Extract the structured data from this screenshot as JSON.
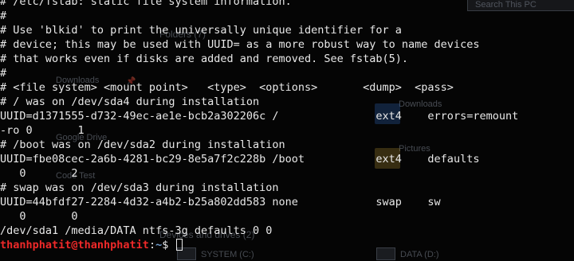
{
  "terminal": {
    "lines": [
      "# /etc/fstab: static file system information.",
      "#",
      "# Use 'blkid' to print the universally unique identifier for a",
      "# device; this may be used with UUID= as a more robust way to name devices",
      "# that works even if disks are added and removed. See fstab(5).",
      "#",
      "# <file system> <mount point>   <type>  <options>       <dump>  <pass>",
      "# / was on /dev/sda4 during installation",
      "UUID=d1371555-d732-49ec-ae1e-bcb2a302206c /               ext4    errors=remount",
      "-ro 0       1",
      "# /boot was on /dev/sda2 during installation",
      "UUID=fbe08cec-2a6b-4281-bc29-8e5a7f2c228b /boot           ext4    defaults",
      "   0       2",
      "# swap was on /dev/sda3 during installation",
      "UUID=44bfdf27-2284-4d32-a4b2-b25a802dd583 none            swap    sw",
      "   0       0",
      "/dev/sda1 /media/DATA ntfs-3g defaults 0 0"
    ],
    "prompt": {
      "user_host": "thanhphatit@thanhphatit",
      "separator": ":",
      "path": "~",
      "symbol": "$ "
    }
  },
  "background": {
    "search_placeholder": "Search This PC",
    "folders_heading": "Folders (7)",
    "downloads_nav": "Downloads",
    "downloads_folder": "Downloads",
    "google_drive": "Google Drive",
    "pictures_folder": "Pictures",
    "code_test": "Code Test",
    "devices_heading": "Devices and drives (2)",
    "drive_system": "SYSTEM (C:)",
    "drive_data": "DATA (D:)"
  }
}
